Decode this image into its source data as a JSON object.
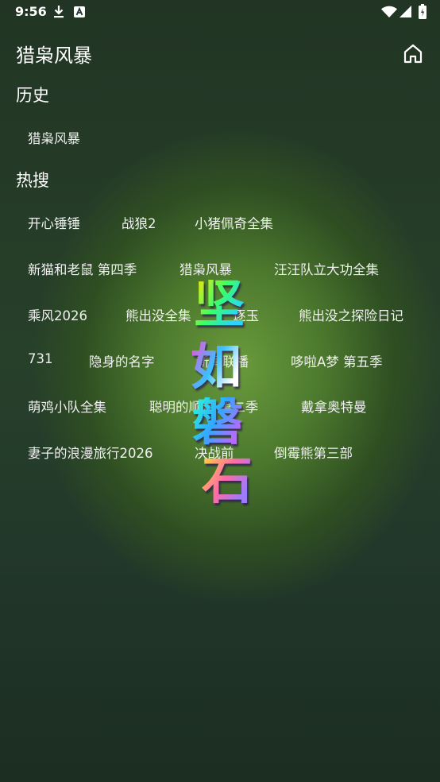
{
  "status_bar": {
    "time": "9:56"
  },
  "app_bar": {
    "title": "猎枭风暴"
  },
  "history": {
    "title": "历史",
    "items": [
      "猎枭风暴"
    ]
  },
  "hot": {
    "title": "热搜",
    "items": [
      "开心锤锤",
      "战狼2",
      "小猪佩奇全集",
      "新猫和老鼠 第四季",
      "猎枭风暴",
      "汪汪队立大功全集",
      "乘风2026",
      "熊出没全集",
      "逐玉",
      "熊出没之探险日记",
      "731",
      "隐身的名字",
      "新闻联播",
      "哆啦A梦 第五季",
      "萌鸡小队全集",
      "聪明的顺溜 第二季",
      "戴拿奥特曼",
      "妻子的浪漫旅行2026",
      "决战前",
      "倒霉熊第三部"
    ]
  },
  "watermark": {
    "chars": [
      "坚",
      "如",
      "磐",
      "石"
    ]
  }
}
